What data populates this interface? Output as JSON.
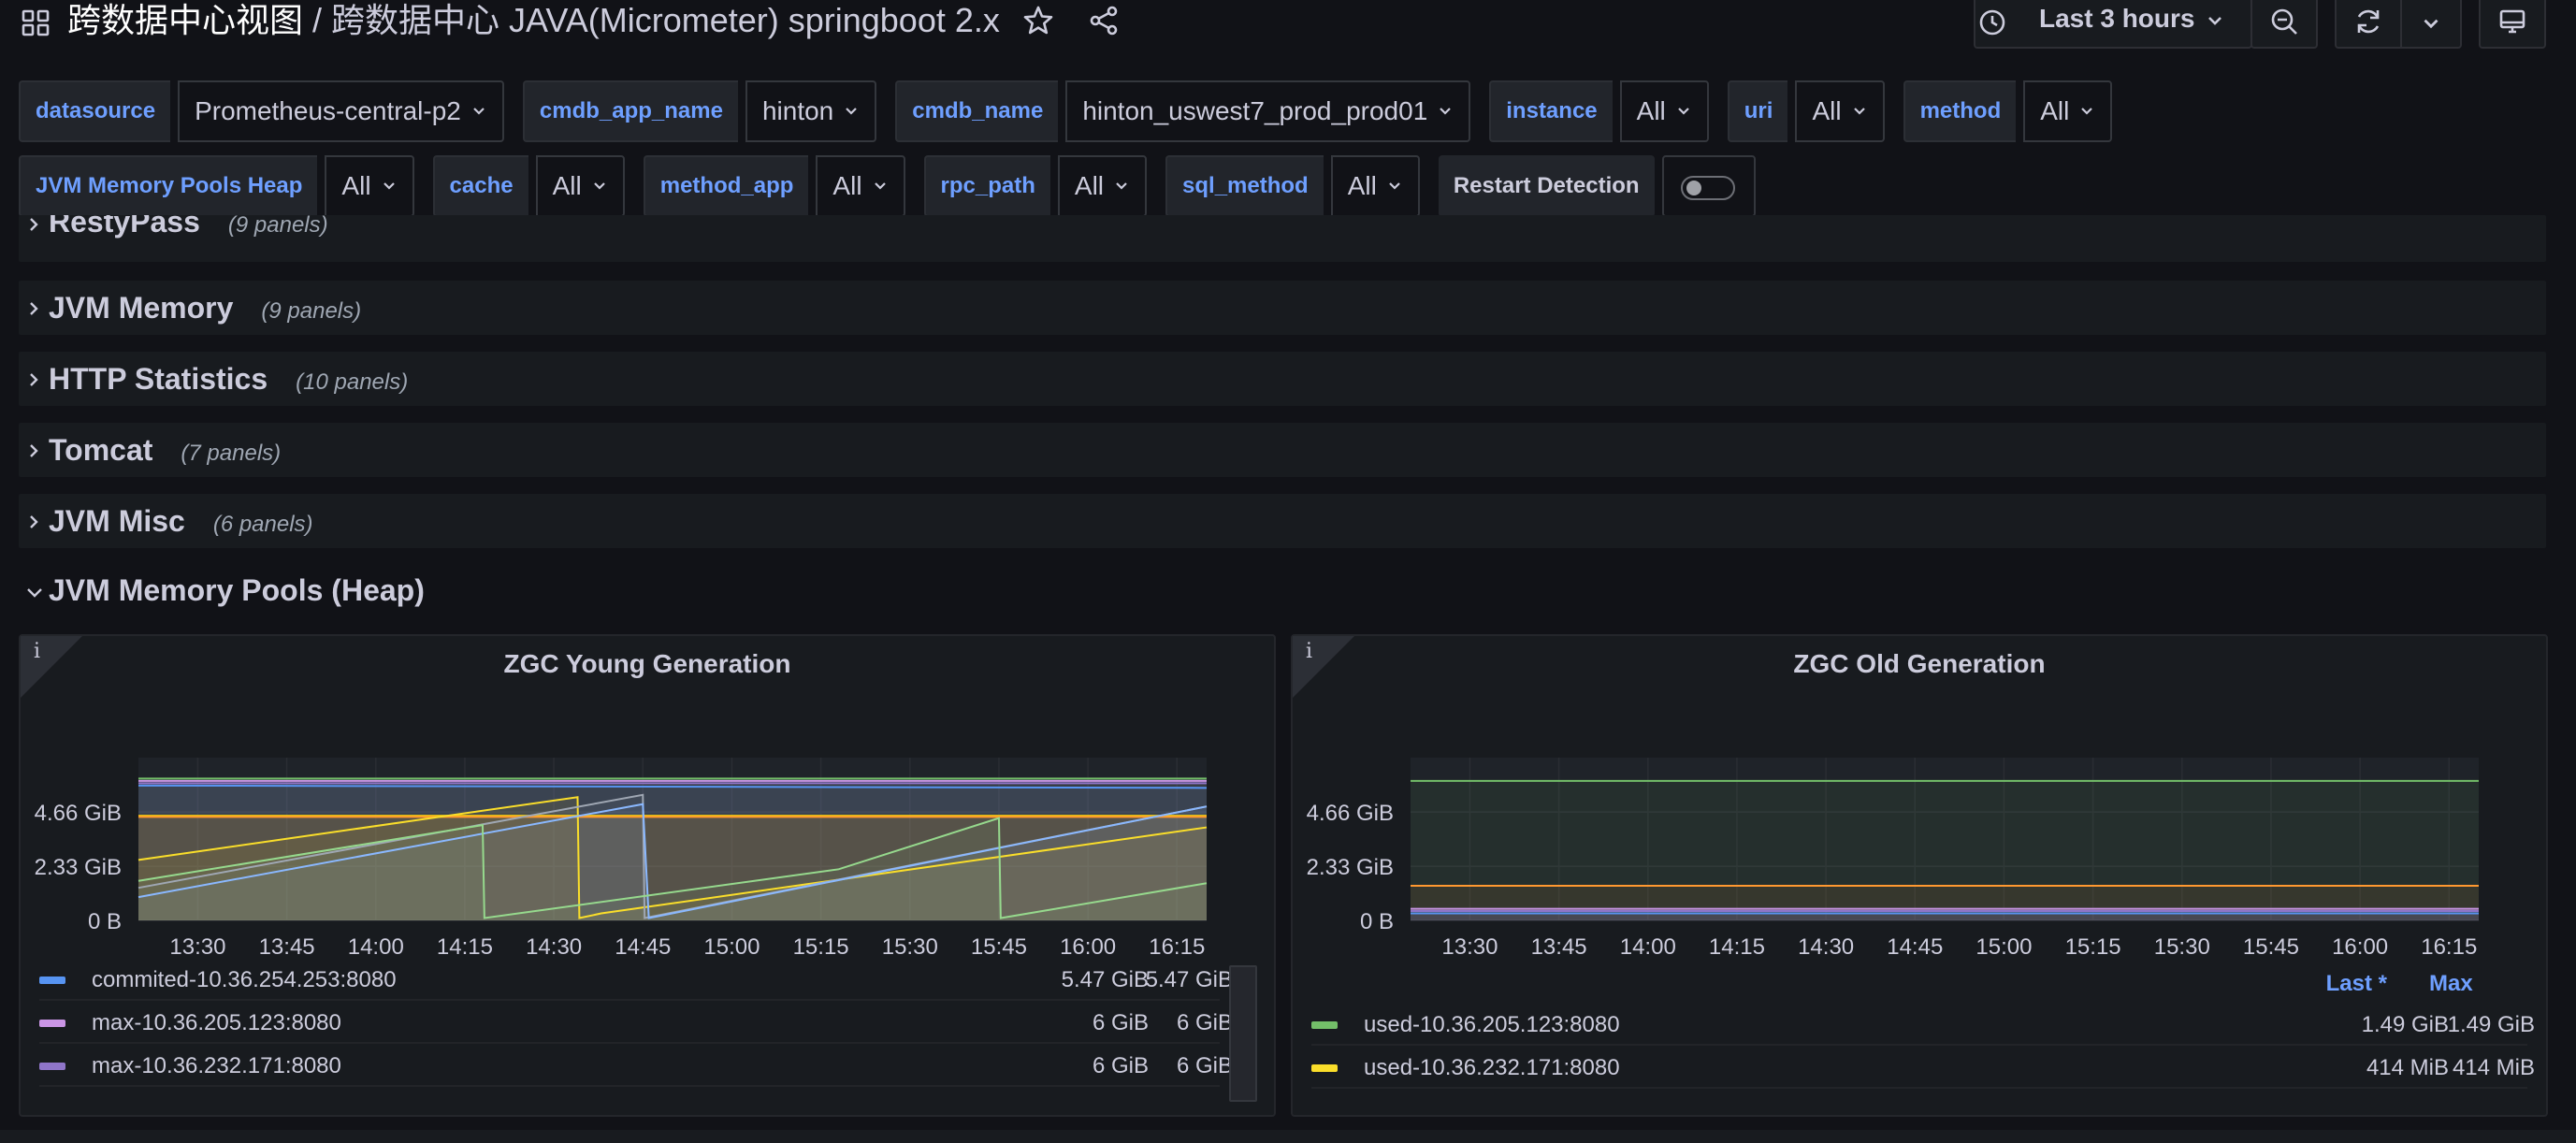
{
  "header": {
    "folder": "跨数据中心视图",
    "separator": "/",
    "dashboard_title": "跨数据中心 JAVA(Micrometer) springboot 2.x",
    "time_range": "Last 3 hours"
  },
  "variables_row1": [
    {
      "label": "datasource",
      "value": "Prometheus-central-p2"
    },
    {
      "label": "cmdb_app_name",
      "value": "hinton"
    },
    {
      "label": "cmdb_name",
      "value": "hinton_uswest7_prod_prod01"
    },
    {
      "label": "instance",
      "value": "All"
    },
    {
      "label": "uri",
      "value": "All"
    },
    {
      "label": "method",
      "value": "All"
    }
  ],
  "variables_row2": [
    {
      "label": "JVM Memory Pools Heap",
      "value": "All"
    },
    {
      "label": "cache",
      "value": "All"
    },
    {
      "label": "method_app",
      "value": "All"
    },
    {
      "label": "rpc_path",
      "value": "All"
    },
    {
      "label": "sql_method",
      "value": "All"
    }
  ],
  "restart_detection": {
    "label": "Restart Detection",
    "enabled": false
  },
  "collapsed_rows": [
    {
      "title": "RestyPass",
      "count": "(9 panels)"
    },
    {
      "title": "JVM Memory",
      "count": "(9 panels)"
    },
    {
      "title": "HTTP Statistics",
      "count": "(10 panels)"
    },
    {
      "title": "Tomcat",
      "count": "(7 panels)"
    },
    {
      "title": "JVM Misc",
      "count": "(6 panels)"
    }
  ],
  "open_row": {
    "title": "JVM Memory Pools (Heap)"
  },
  "panels": [
    {
      "title": "ZGC Young Generation",
      "info_icon": "i",
      "legend": [
        {
          "name": "commited-10.36.254.253:8080",
          "v1": "5.47 GiB",
          "v2": "5.47 GiB",
          "color": "#5794f2"
        },
        {
          "name": "max-10.36.205.123:8080",
          "v1": "6 GiB",
          "v2": "6 GiB",
          "color": "#ca95e5"
        },
        {
          "name": "max-10.36.232.171:8080",
          "v1": "6 GiB",
          "v2": "6 GiB",
          "color": "#8f75c9"
        }
      ]
    },
    {
      "title": "ZGC Old Generation",
      "info_icon": "i",
      "legend_headers": {
        "last": "Last *",
        "max": "Max"
      },
      "legend": [
        {
          "name": "used-10.36.205.123:8080",
          "v1": "1.49 GiB",
          "v2": "1.49 GiB",
          "color": "#73bf69"
        },
        {
          "name": "used-10.36.232.171:8080",
          "v1": "414 MiB",
          "v2": "414 MiB",
          "color": "#fade2a"
        }
      ]
    }
  ],
  "chart_data": [
    {
      "type": "area",
      "title": "ZGC Young Generation",
      "y_unit": "GiB",
      "ylim": [
        0,
        7
      ],
      "y_ticks": [
        "0 B",
        "2.33 GiB",
        "4.66 GiB"
      ],
      "x_ticks": [
        "13:30",
        "13:45",
        "14:00",
        "14:15",
        "14:30",
        "14:45",
        "15:00",
        "15:15",
        "15:30",
        "15:45",
        "16:00",
        "16:15"
      ],
      "x_range": [
        "13:20",
        "16:20"
      ],
      "series": [
        {
          "name": "max-10.36.205.123:8080",
          "color": "#ca95e5",
          "values": [
            [
              0,
              6.0
            ],
            [
              180,
              6.0
            ]
          ]
        },
        {
          "name": "max-10.36.232.171:8080",
          "color": "#8f75c9",
          "values": [
            [
              0,
              5.9
            ],
            [
              180,
              5.9
            ]
          ]
        },
        {
          "color": "#73bf69",
          "values": [
            [
              0,
              6.1
            ],
            [
              180,
              6.1
            ]
          ]
        },
        {
          "name": "commited-10.36.254.253:8080",
          "color": "#5794f2",
          "values": [
            [
              0,
              5.8
            ],
            [
              180,
              5.7
            ]
          ]
        },
        {
          "color": "#f2cc0c",
          "values": [
            [
              0,
              4.5
            ],
            [
              180,
              4.5
            ]
          ]
        },
        {
          "color": "#ff9830",
          "values": [
            [
              0,
              4.45
            ],
            [
              180,
              4.45
            ]
          ]
        },
        {
          "color": "#fade2a",
          "values": [
            [
              0,
              2.6
            ],
            [
              74,
              5.3
            ],
            [
              74.3,
              0.1
            ],
            [
              78,
              0.3
            ],
            [
              180,
              4.0
            ]
          ]
        },
        {
          "color": "#9fa7b3",
          "values": [
            [
              0,
              1.4
            ],
            [
              85,
              5.4
            ],
            [
              85.3,
              0.1
            ],
            [
              180,
              4.9
            ]
          ]
        },
        {
          "color": "#8ab8ff",
          "values": [
            [
              0,
              1.0
            ],
            [
              85,
              5.0
            ],
            [
              86,
              0.1
            ],
            [
              180,
              4.9
            ]
          ]
        },
        {
          "color": "#96d98d",
          "values": [
            [
              0,
              1.7
            ],
            [
              58,
              4.1
            ],
            [
              58.3,
              0.1
            ],
            [
              118,
              2.2
            ],
            [
              145,
              4.4
            ],
            [
              145.3,
              0.1
            ],
            [
              180,
              1.6
            ]
          ]
        }
      ]
    },
    {
      "type": "area",
      "title": "ZGC Old Generation",
      "y_unit": "GiB",
      "ylim": [
        0,
        7
      ],
      "y_ticks": [
        "0 B",
        "2.33 GiB",
        "4.66 GiB"
      ],
      "x_ticks": [
        "13:30",
        "13:45",
        "14:00",
        "14:15",
        "14:30",
        "14:45",
        "15:00",
        "15:15",
        "15:30",
        "15:45",
        "16:00",
        "16:15"
      ],
      "x_range": [
        "13:20",
        "16:20"
      ],
      "series": [
        {
          "color": "#73bf69",
          "values": [
            [
              0,
              6.0
            ],
            [
              180,
              6.0
            ]
          ]
        },
        {
          "color": "#ff9830",
          "values": [
            [
              0,
              1.49
            ],
            [
              180,
              1.49
            ]
          ]
        },
        {
          "name": "used-10.36.205.123:8080",
          "color": "#ca95e5",
          "values": [
            [
              0,
              0.5
            ],
            [
              180,
              0.5
            ]
          ]
        },
        {
          "name": "used-10.36.232.171:8080",
          "color": "#8f75c9",
          "values": [
            [
              0,
              0.404
            ],
            [
              180,
              0.404
            ]
          ]
        },
        {
          "color": "#5794f2",
          "values": [
            [
              0,
              0.3
            ],
            [
              180,
              0.3
            ]
          ]
        }
      ]
    }
  ]
}
